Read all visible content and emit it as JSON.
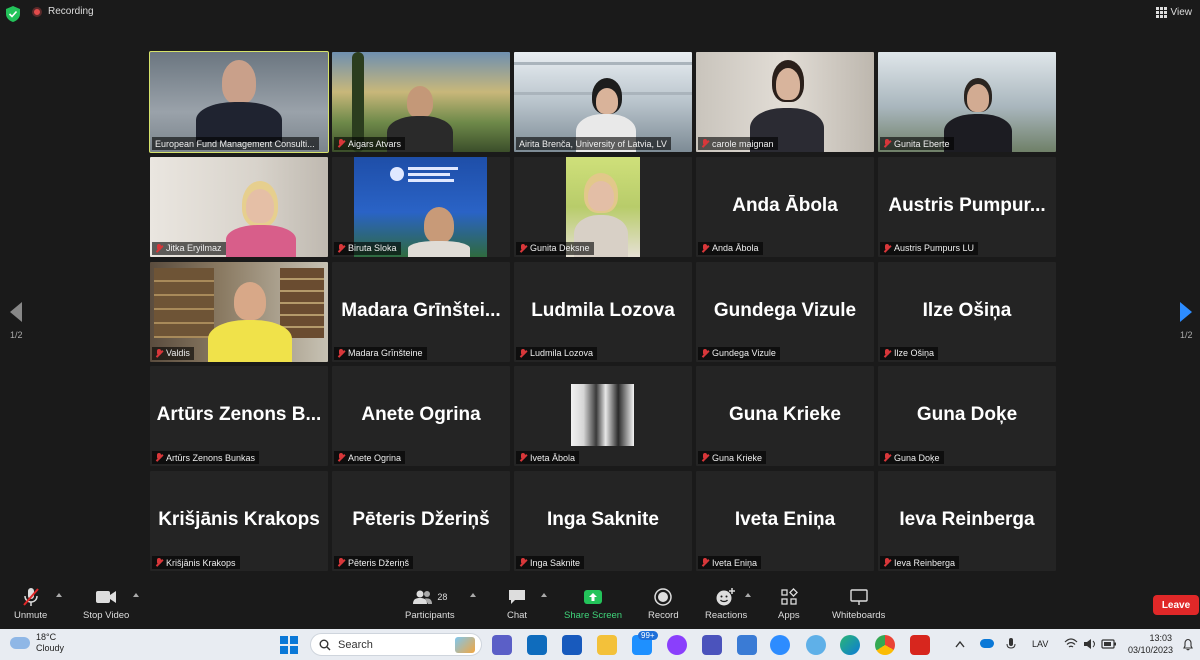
{
  "topbar": {
    "recording_label": "Recording",
    "view_label": "View"
  },
  "tiles": [
    {
      "name": "European Fund Management Consulti...",
      "video": true,
      "active": true,
      "muted": false
    },
    {
      "name": "Aigars Atvars",
      "video": true,
      "muted": true
    },
    {
      "name": "Airita Brenča, University of Latvia, LV",
      "video": true,
      "muted": false
    },
    {
      "name": "carole maignan",
      "video": true,
      "muted": true
    },
    {
      "name": "Gunita Eberte",
      "video": true,
      "muted": true
    },
    {
      "name": "Jitka Eryilmaz",
      "video": true,
      "muted": true
    },
    {
      "name": "Biruta Sloka",
      "video": true,
      "muted": true
    },
    {
      "name": "Gunita Deksne",
      "video": true,
      "muted": true
    },
    {
      "name": "Anda Ābola",
      "big": "Anda Ābola",
      "video": false,
      "muted": true
    },
    {
      "name": "Austris Pumpurs LU",
      "big": "Austris  Pumpur...",
      "video": false,
      "muted": true
    },
    {
      "name": "Valdis",
      "video": true,
      "muted": true
    },
    {
      "name": "Madara Grīnšteine",
      "big": "Madara  Grīnštei...",
      "video": false,
      "muted": true
    },
    {
      "name": "Ludmila Lozova",
      "big": "Ludmila Lozova",
      "video": false,
      "muted": true
    },
    {
      "name": "Gundega Vizule",
      "big": "Gundega Vizule",
      "video": false,
      "muted": true
    },
    {
      "name": "Ilze Ošiņa",
      "big": "Ilze Ošiņa",
      "video": false,
      "muted": true
    },
    {
      "name": "Artūrs Zenons Bunkas",
      "big": "Artūrs  Zenons  B...",
      "video": false,
      "muted": true
    },
    {
      "name": "Anete Ogrina",
      "big": "Anete Ogrina",
      "video": false,
      "muted": true
    },
    {
      "name": "Iveta Ābola",
      "video": false,
      "avatar": true,
      "muted": true
    },
    {
      "name": "Guna Krieke",
      "big": "Guna Krieke",
      "video": false,
      "muted": true
    },
    {
      "name": "Guna Doķe",
      "big": "Guna Doķe",
      "video": false,
      "muted": true
    },
    {
      "name": "Krišjānis Krakops",
      "big": "Krišjānis Krakops",
      "video": false,
      "muted": true
    },
    {
      "name": "Pēteris Džeriņš",
      "big": "Pēteris Džeriņš",
      "video": false,
      "muted": true
    },
    {
      "name": "Inga Saknite",
      "big": "Inga Saknite",
      "video": false,
      "muted": true
    },
    {
      "name": "Iveta Eniņa",
      "big": "Iveta Eniņa",
      "video": false,
      "muted": true
    },
    {
      "name": "Ieva Reinberga",
      "big": "Ieva Reinberga",
      "video": false,
      "muted": true
    }
  ],
  "pager": {
    "left": "1/2",
    "right": "1/2"
  },
  "controls": {
    "unmute": "Unmute",
    "stop_video": "Stop Video",
    "participants": "Participants",
    "participants_count": "28",
    "chat": "Chat",
    "share_screen": "Share Screen",
    "record": "Record",
    "reactions": "Reactions",
    "apps": "Apps",
    "whiteboards": "Whiteboards",
    "leave": "Leave"
  },
  "taskbar": {
    "temp": "18°C",
    "weather": "Cloudy",
    "search": "Search",
    "badge": "99+",
    "lang": "LAV",
    "time": "13:03",
    "date": "03/10/2023"
  },
  "colors": {
    "accent_blue": "#2d8cff",
    "leave_red": "#e02828",
    "active_border": "#d6e36a",
    "share_green": "#23c35a"
  }
}
